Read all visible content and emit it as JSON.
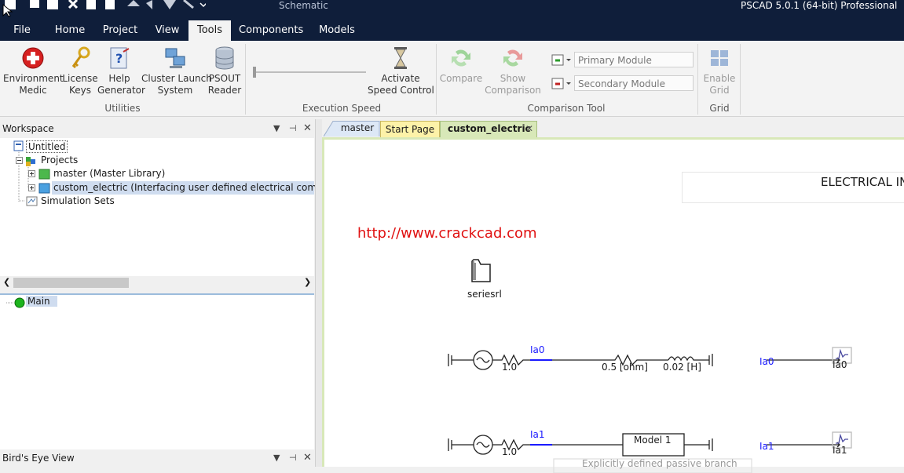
{
  "titlebar": {
    "document": "Schematic",
    "app": "PSCAD 5.0.1 (64-bit) Professional"
  },
  "menu": {
    "tabs": [
      "File",
      "Home",
      "Project",
      "View",
      "Tools",
      "Components",
      "Models"
    ],
    "active": "Tools"
  },
  "ribbon": {
    "buttons": {
      "env_medic": "Environment\nMedic",
      "license_keys": "License\nKeys",
      "help_generator": "Help\nGenerator",
      "cluster_launch": "Cluster Launch\nSystem",
      "psout_reader": "PSOUT\nReader",
      "activate_speed": "Activate\nSpeed Control",
      "compare": "Compare",
      "show_comparison": "Show\nComparison",
      "enable_grid": "Enable\nGrid"
    },
    "groups": {
      "utilities": "Utilities",
      "execution_speed": "Execution Speed",
      "comparison_tool": "Comparison Tool",
      "grid": "Grid"
    },
    "combos": {
      "primary": "Primary Module",
      "secondary": "Secondary Module"
    }
  },
  "workspace": {
    "title": "Workspace",
    "tree": {
      "root": "Untitled",
      "projects": "Projects",
      "master": "master (Master Library)",
      "custom": "custom_electric (Interfacing user defined electrical compone",
      "sim_sets": "Simulation Sets"
    },
    "main_item": "Main"
  },
  "birds_eye": {
    "title": "Bird's Eye View"
  },
  "doc_tabs": {
    "master": "master",
    "start": "Start Page",
    "custom": "custom_electric"
  },
  "canvas": {
    "header": "ELECTRICAL IN",
    "watermark": "http://www.crackcad.com",
    "module_label": "seriesrl",
    "row1": {
      "r1": "1.0",
      "signal": "Ia0",
      "r2": "0.5 [ohm]",
      "l": "0.02 [H]",
      "meter_in": "Ia0",
      "meter_out": "Ia0"
    },
    "row2": {
      "r1": "1.0",
      "signal": "Ia1",
      "model": "Model 1",
      "meter_in": "Ia1",
      "meter_out": "Ia1",
      "caption": "Explicitly defined passive branch"
    }
  },
  "colors": {
    "titlebar": "#0f1e3a",
    "watermark": "#e01010",
    "signal": "#1a1aff"
  }
}
